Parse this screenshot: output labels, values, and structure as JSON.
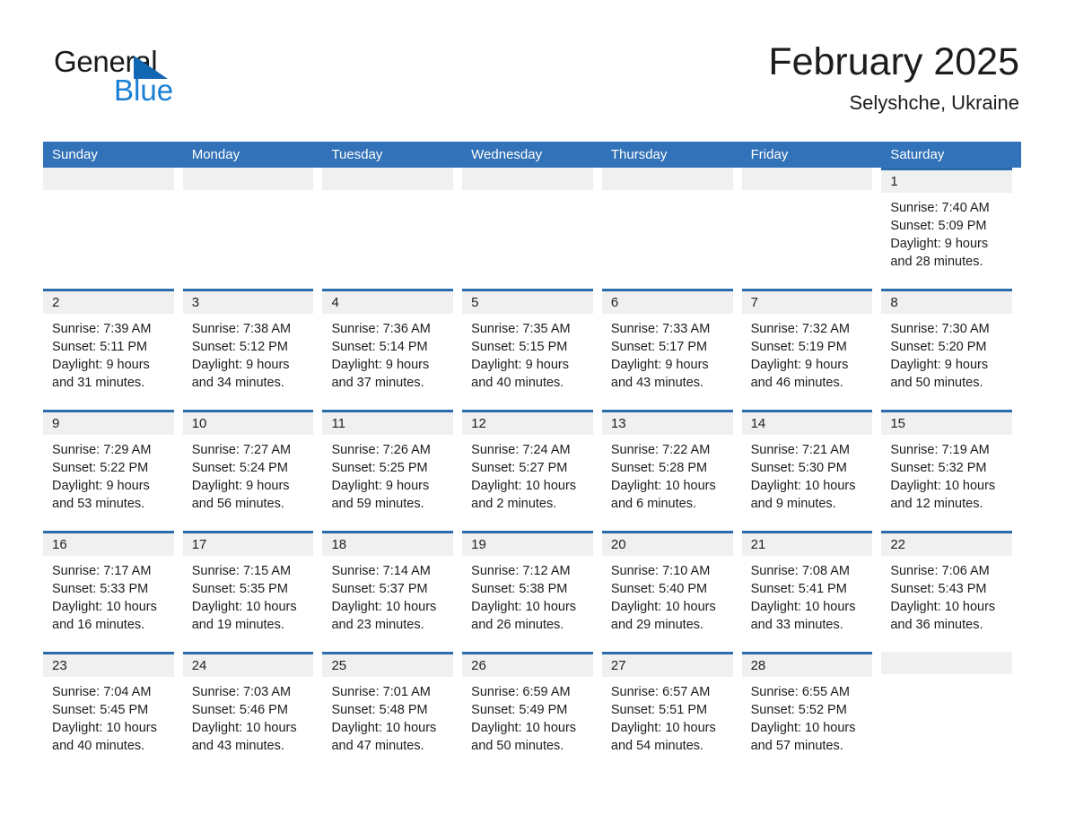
{
  "brand": {
    "name_part1": "General",
    "name_part2": "Blue",
    "accent_color": "#1a7fd4",
    "triangle_color": "#1267b2"
  },
  "header": {
    "month_title": "February 2025",
    "location": "Selyshche, Ukraine"
  },
  "theme": {
    "header_row_color": "#3272b8",
    "row_top_border_color": "#2b6cac",
    "date_band_color": "#f0f0f0",
    "text_color": "#1c1c1c"
  },
  "weekdays": [
    "Sunday",
    "Monday",
    "Tuesday",
    "Wednesday",
    "Thursday",
    "Friday",
    "Saturday"
  ],
  "labels": {
    "sunrise_prefix": "Sunrise:",
    "sunset_prefix": "Sunset:",
    "daylight_prefix": "Daylight:"
  },
  "weeks": [
    [
      {
        "empty": true
      },
      {
        "empty": true
      },
      {
        "empty": true
      },
      {
        "empty": true
      },
      {
        "empty": true
      },
      {
        "empty": true
      },
      {
        "day": "1",
        "sunrise": "Sunrise: 7:40 AM",
        "sunset": "Sunset: 5:09 PM",
        "daylight1": "Daylight: 9 hours",
        "daylight2": "and 28 minutes."
      }
    ],
    [
      {
        "day": "2",
        "sunrise": "Sunrise: 7:39 AM",
        "sunset": "Sunset: 5:11 PM",
        "daylight1": "Daylight: 9 hours",
        "daylight2": "and 31 minutes."
      },
      {
        "day": "3",
        "sunrise": "Sunrise: 7:38 AM",
        "sunset": "Sunset: 5:12 PM",
        "daylight1": "Daylight: 9 hours",
        "daylight2": "and 34 minutes."
      },
      {
        "day": "4",
        "sunrise": "Sunrise: 7:36 AM",
        "sunset": "Sunset: 5:14 PM",
        "daylight1": "Daylight: 9 hours",
        "daylight2": "and 37 minutes."
      },
      {
        "day": "5",
        "sunrise": "Sunrise: 7:35 AM",
        "sunset": "Sunset: 5:15 PM",
        "daylight1": "Daylight: 9 hours",
        "daylight2": "and 40 minutes."
      },
      {
        "day": "6",
        "sunrise": "Sunrise: 7:33 AM",
        "sunset": "Sunset: 5:17 PM",
        "daylight1": "Daylight: 9 hours",
        "daylight2": "and 43 minutes."
      },
      {
        "day": "7",
        "sunrise": "Sunrise: 7:32 AM",
        "sunset": "Sunset: 5:19 PM",
        "daylight1": "Daylight: 9 hours",
        "daylight2": "and 46 minutes."
      },
      {
        "day": "8",
        "sunrise": "Sunrise: 7:30 AM",
        "sunset": "Sunset: 5:20 PM",
        "daylight1": "Daylight: 9 hours",
        "daylight2": "and 50 minutes."
      }
    ],
    [
      {
        "day": "9",
        "sunrise": "Sunrise: 7:29 AM",
        "sunset": "Sunset: 5:22 PM",
        "daylight1": "Daylight: 9 hours",
        "daylight2": "and 53 minutes."
      },
      {
        "day": "10",
        "sunrise": "Sunrise: 7:27 AM",
        "sunset": "Sunset: 5:24 PM",
        "daylight1": "Daylight: 9 hours",
        "daylight2": "and 56 minutes."
      },
      {
        "day": "11",
        "sunrise": "Sunrise: 7:26 AM",
        "sunset": "Sunset: 5:25 PM",
        "daylight1": "Daylight: 9 hours",
        "daylight2": "and 59 minutes."
      },
      {
        "day": "12",
        "sunrise": "Sunrise: 7:24 AM",
        "sunset": "Sunset: 5:27 PM",
        "daylight1": "Daylight: 10 hours",
        "daylight2": "and 2 minutes."
      },
      {
        "day": "13",
        "sunrise": "Sunrise: 7:22 AM",
        "sunset": "Sunset: 5:28 PM",
        "daylight1": "Daylight: 10 hours",
        "daylight2": "and 6 minutes."
      },
      {
        "day": "14",
        "sunrise": "Sunrise: 7:21 AM",
        "sunset": "Sunset: 5:30 PM",
        "daylight1": "Daylight: 10 hours",
        "daylight2": "and 9 minutes."
      },
      {
        "day": "15",
        "sunrise": "Sunrise: 7:19 AM",
        "sunset": "Sunset: 5:32 PM",
        "daylight1": "Daylight: 10 hours",
        "daylight2": "and 12 minutes."
      }
    ],
    [
      {
        "day": "16",
        "sunrise": "Sunrise: 7:17 AM",
        "sunset": "Sunset: 5:33 PM",
        "daylight1": "Daylight: 10 hours",
        "daylight2": "and 16 minutes."
      },
      {
        "day": "17",
        "sunrise": "Sunrise: 7:15 AM",
        "sunset": "Sunset: 5:35 PM",
        "daylight1": "Daylight: 10 hours",
        "daylight2": "and 19 minutes."
      },
      {
        "day": "18",
        "sunrise": "Sunrise: 7:14 AM",
        "sunset": "Sunset: 5:37 PM",
        "daylight1": "Daylight: 10 hours",
        "daylight2": "and 23 minutes."
      },
      {
        "day": "19",
        "sunrise": "Sunrise: 7:12 AM",
        "sunset": "Sunset: 5:38 PM",
        "daylight1": "Daylight: 10 hours",
        "daylight2": "and 26 minutes."
      },
      {
        "day": "20",
        "sunrise": "Sunrise: 7:10 AM",
        "sunset": "Sunset: 5:40 PM",
        "daylight1": "Daylight: 10 hours",
        "daylight2": "and 29 minutes."
      },
      {
        "day": "21",
        "sunrise": "Sunrise: 7:08 AM",
        "sunset": "Sunset: 5:41 PM",
        "daylight1": "Daylight: 10 hours",
        "daylight2": "and 33 minutes."
      },
      {
        "day": "22",
        "sunrise": "Sunrise: 7:06 AM",
        "sunset": "Sunset: 5:43 PM",
        "daylight1": "Daylight: 10 hours",
        "daylight2": "and 36 minutes."
      }
    ],
    [
      {
        "day": "23",
        "sunrise": "Sunrise: 7:04 AM",
        "sunset": "Sunset: 5:45 PM",
        "daylight1": "Daylight: 10 hours",
        "daylight2": "and 40 minutes."
      },
      {
        "day": "24",
        "sunrise": "Sunrise: 7:03 AM",
        "sunset": "Sunset: 5:46 PM",
        "daylight1": "Daylight: 10 hours",
        "daylight2": "and 43 minutes."
      },
      {
        "day": "25",
        "sunrise": "Sunrise: 7:01 AM",
        "sunset": "Sunset: 5:48 PM",
        "daylight1": "Daylight: 10 hours",
        "daylight2": "and 47 minutes."
      },
      {
        "day": "26",
        "sunrise": "Sunrise: 6:59 AM",
        "sunset": "Sunset: 5:49 PM",
        "daylight1": "Daylight: 10 hours",
        "daylight2": "and 50 minutes."
      },
      {
        "day": "27",
        "sunrise": "Sunrise: 6:57 AM",
        "sunset": "Sunset: 5:51 PM",
        "daylight1": "Daylight: 10 hours",
        "daylight2": "and 54 minutes."
      },
      {
        "day": "28",
        "sunrise": "Sunrise: 6:55 AM",
        "sunset": "Sunset: 5:52 PM",
        "daylight1": "Daylight: 10 hours",
        "daylight2": "and 57 minutes."
      },
      {
        "empty": true
      }
    ]
  ]
}
